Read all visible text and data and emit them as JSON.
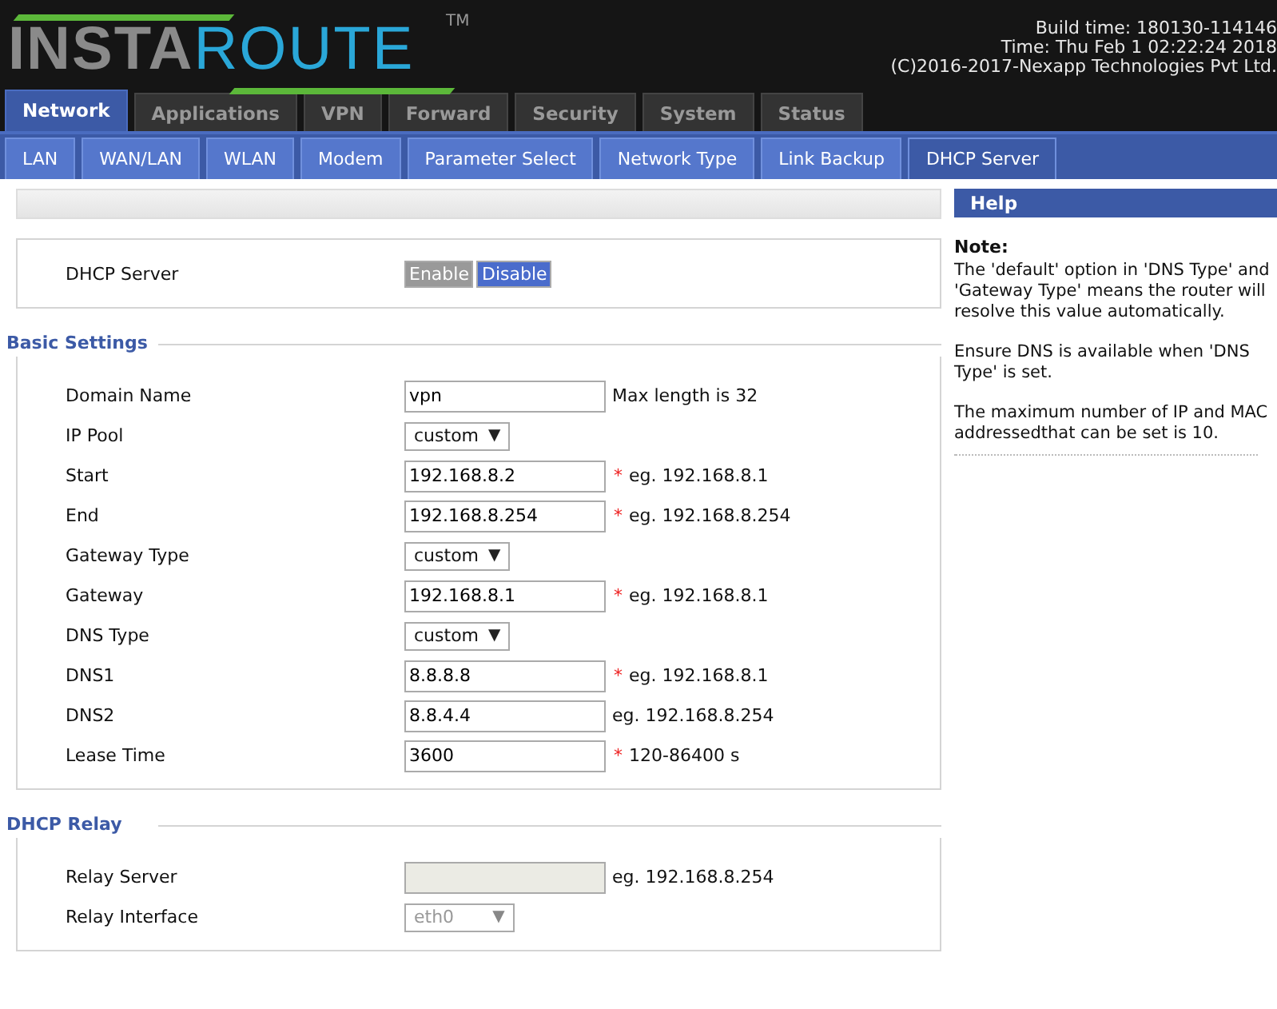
{
  "logo": {
    "first": "INSTA",
    "second": "ROUTE",
    "tm": "TM"
  },
  "build_info": [
    "Build time: 180130-114146",
    "Time: Thu Feb 1 02:22:24 2018",
    "(C)2016-2017-Nexapp Technologies Pvt Ltd."
  ],
  "tabs": [
    {
      "label": "Network",
      "selected": true
    },
    {
      "label": "Applications",
      "selected": false
    },
    {
      "label": "VPN",
      "selected": false
    },
    {
      "label": "Forward",
      "selected": false
    },
    {
      "label": "Security",
      "selected": false
    },
    {
      "label": "System",
      "selected": false
    },
    {
      "label": "Status",
      "selected": false
    }
  ],
  "subtabs": [
    {
      "label": "LAN",
      "selected": false
    },
    {
      "label": "WAN/LAN",
      "selected": false
    },
    {
      "label": "WLAN",
      "selected": false
    },
    {
      "label": "Modem",
      "selected": false
    },
    {
      "label": "Parameter Select",
      "selected": false
    },
    {
      "label": "Network Type",
      "selected": false
    },
    {
      "label": "Link Backup",
      "selected": false
    },
    {
      "label": "DHCP Server",
      "selected": true
    }
  ],
  "dhcp_server": {
    "label": "DHCP Server",
    "options": [
      {
        "label": "Enable",
        "selected": false
      },
      {
        "label": "Disable",
        "selected": true
      }
    ]
  },
  "sections": [
    {
      "title": "Basic Settings",
      "rows": [
        {
          "label": "Domain Name",
          "kind": "text",
          "value": "vpn",
          "hint": "Max length is 32",
          "disabled": false
        },
        {
          "label": "IP Pool",
          "kind": "select",
          "value": "custom",
          "arrow": "▼",
          "disabled": false
        },
        {
          "label": "Start",
          "kind": "text",
          "value": "192.168.8.2",
          "required_mark": "*",
          "hint": "eg. 192.168.8.1",
          "disabled": false
        },
        {
          "label": "End",
          "kind": "text",
          "value": "192.168.8.254",
          "required_mark": "*",
          "hint": "eg. 192.168.8.254",
          "disabled": false
        },
        {
          "label": "Gateway Type",
          "kind": "select",
          "value": "custom",
          "arrow": "▼",
          "disabled": false
        },
        {
          "label": "Gateway",
          "kind": "text",
          "value": "192.168.8.1",
          "required_mark": "*",
          "hint": "eg. 192.168.8.1",
          "disabled": false
        },
        {
          "label": "DNS Type",
          "kind": "select",
          "value": "custom",
          "arrow": "▼",
          "disabled": false
        },
        {
          "label": "DNS1",
          "kind": "text",
          "value": "8.8.8.8",
          "required_mark": "*",
          "hint": "eg. 192.168.8.1",
          "disabled": false
        },
        {
          "label": "DNS2",
          "kind": "text",
          "value": "8.8.4.4",
          "hint": "eg. 192.168.8.254",
          "disabled": false
        },
        {
          "label": "Lease Time",
          "kind": "text",
          "value": "3600",
          "required_mark": "*",
          "hint": "120-86400 s",
          "disabled": false
        }
      ]
    },
    {
      "title": "DHCP Relay",
      "rows": [
        {
          "label": "Relay Server",
          "kind": "text",
          "hint": "eg. 192.168.8.254",
          "disabled": true
        },
        {
          "label": "Relay Interface",
          "kind": "select",
          "value": "eth0",
          "arrow": "▼",
          "disabled": true
        }
      ]
    }
  ],
  "help": {
    "title": "Help",
    "note_title": "Note:",
    "paragraphs": [
      "The 'default' option in 'DNS Type' and 'Gateway Type' means the router will resolve this value automatically.",
      "Ensure DNS is available when 'DNS Type' is set.",
      "The maximum number of IP and MAC addressedthat can be set is 10."
    ]
  }
}
